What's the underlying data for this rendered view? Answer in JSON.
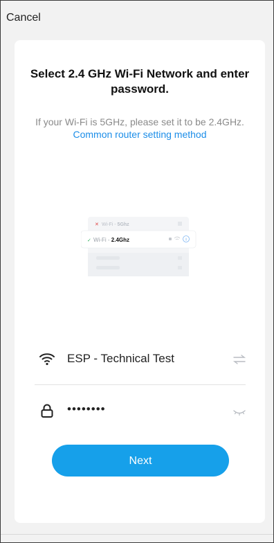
{
  "header": {
    "cancel_label": "Cancel"
  },
  "card": {
    "title": "Select 2.4 GHz Wi-Fi Network and enter password.",
    "hint_prefix": "If your Wi-Fi is 5GHz, please set it to be 2.4GHz. ",
    "hint_link": "Common router setting method"
  },
  "illustration": {
    "row1_prefix": "Wi-Fi - ",
    "row1_band": "5Ghz",
    "row2_prefix": "Wi-Fi - ",
    "row2_band": "2.4Ghz"
  },
  "form": {
    "ssid_value": "ESP - Technical Test",
    "password_value": "••••••••"
  },
  "actions": {
    "next_label": "Next"
  },
  "colors": {
    "accent": "#16a0ea",
    "link": "#1b8de8"
  },
  "icons": {
    "ssid": "wifi-icon",
    "switch": "switch-network-icon",
    "lock": "lock-icon",
    "visibility": "eye-closed-icon"
  }
}
